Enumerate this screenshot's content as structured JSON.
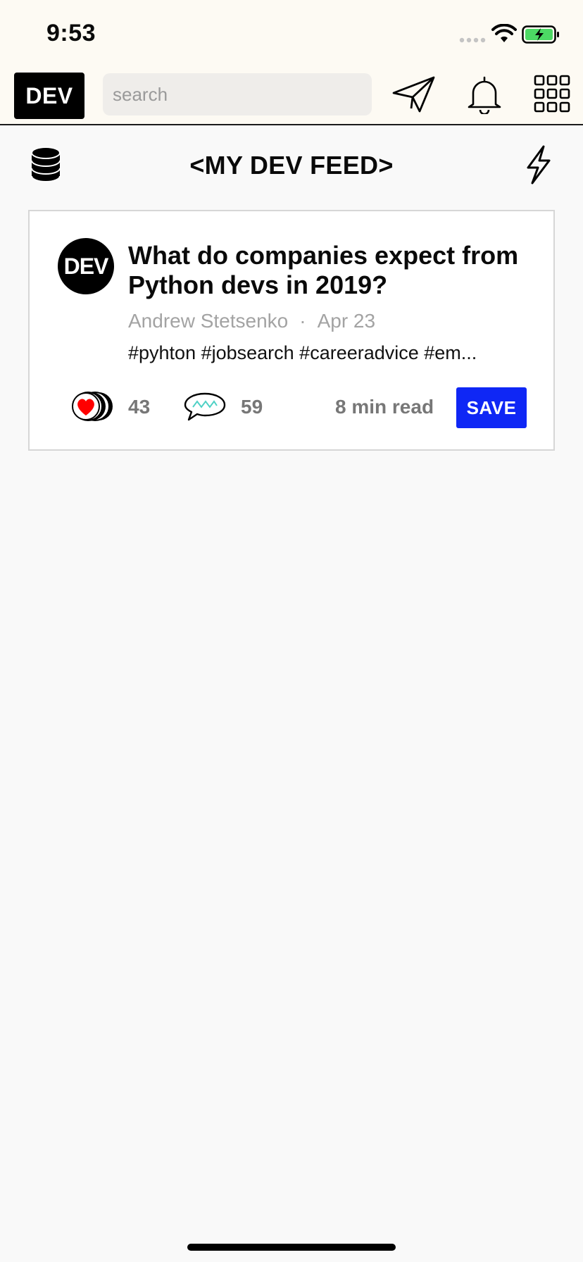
{
  "status_bar": {
    "time": "9:53"
  },
  "top_nav": {
    "logo_text": "DEV",
    "search_placeholder": "search",
    "icons": [
      "send-icon",
      "bell-icon",
      "grid-menu-icon"
    ]
  },
  "feed_header": {
    "title": "<MY DEV FEED>",
    "left_icon": "database-icon",
    "right_icon": "lightning-bolt-icon"
  },
  "article": {
    "avatar_text": "DEV",
    "title": "What do companies expect from Python devs in 2019?",
    "author": "Andrew Stetsenko",
    "separator": "·",
    "date": "Apr 23",
    "tags": "#pyhton #jobsearch #careeradvice #em...",
    "reactions_count": "43",
    "comments_count": "59",
    "read_time": "8 min read",
    "save_label": "SAVE"
  },
  "colors": {
    "accent": "#0f27f5",
    "heart": "#ff0000",
    "comment_wave": "#4fd1c5",
    "battery_fill": "#4cd964"
  }
}
